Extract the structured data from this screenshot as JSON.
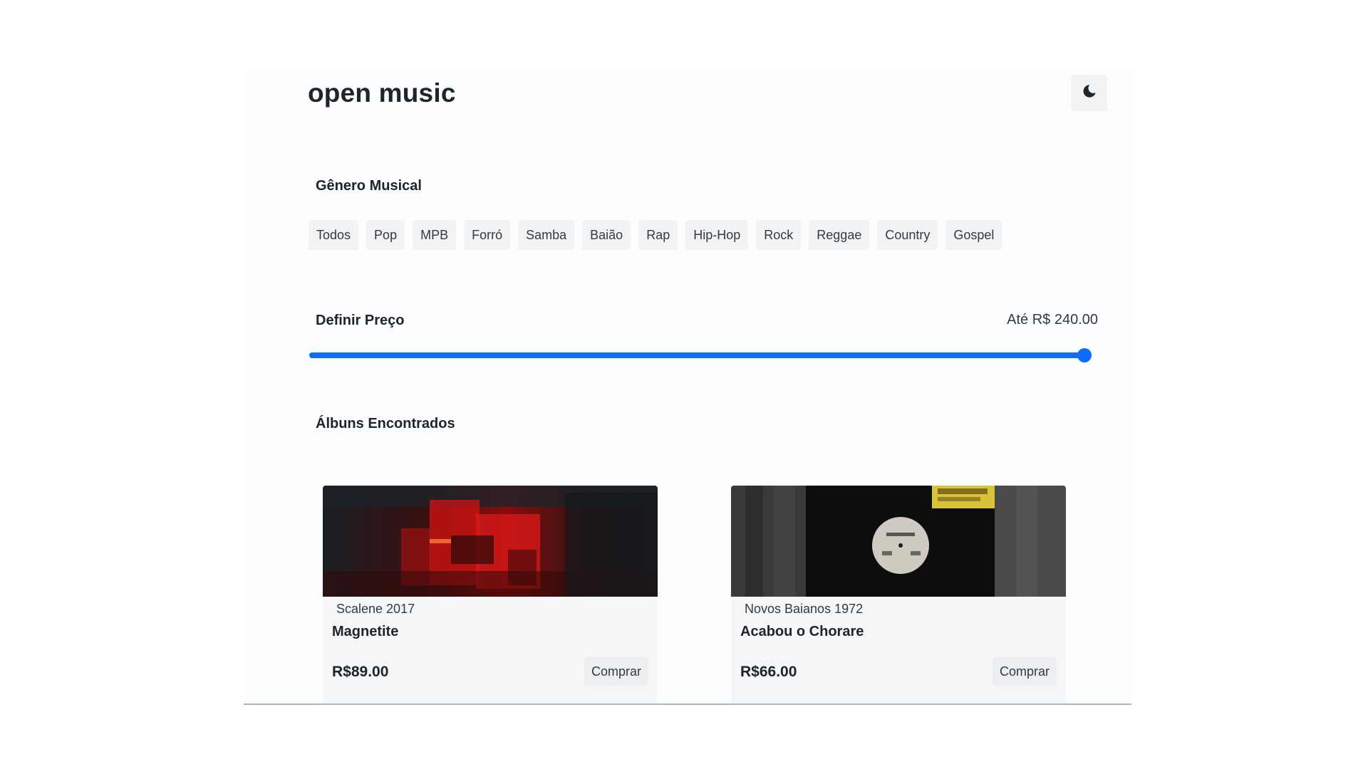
{
  "header": {
    "logo": "open music",
    "theme_toggle_icon": "moon-icon"
  },
  "genres": {
    "title": "Gênero Musical",
    "items": [
      "Todos",
      "Pop",
      "MPB",
      "Forró",
      "Samba",
      "Baião",
      "Rap",
      "Hip-Hop",
      "Rock",
      "Reggae",
      "Country",
      "Gospel"
    ]
  },
  "price": {
    "title": "Definir Preço",
    "value_label": "Até R$ 240.00",
    "slider_fraction": 1.0,
    "accent_color": "#0d6efd"
  },
  "albums": {
    "title": "Álbuns Encontrados",
    "items": [
      {
        "meta": "Scalene 2017",
        "title": "Magnetite",
        "price": "R$89.00",
        "buy_label": "Comprar",
        "cover": "red-reflection-cover"
      },
      {
        "meta": "Novos Baianos 1972",
        "title": "Acabou o Chorare",
        "price": "R$66.00",
        "buy_label": "Comprar",
        "cover": "vinyl-record-cover"
      }
    ]
  }
}
